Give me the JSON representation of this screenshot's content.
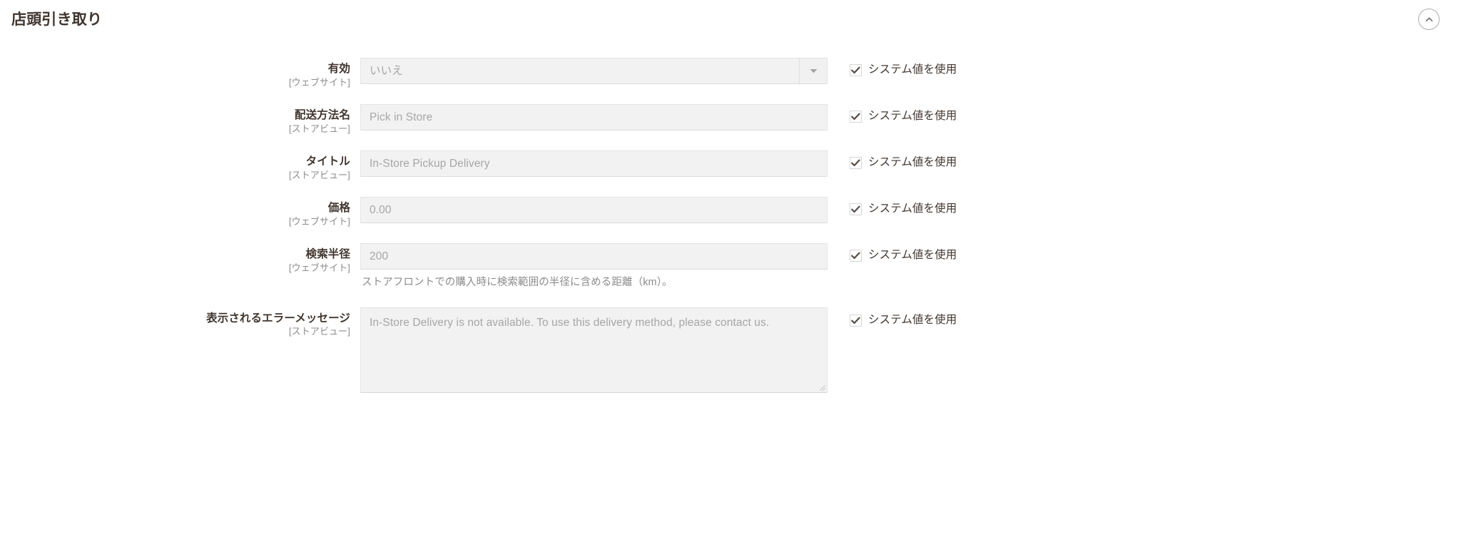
{
  "section": {
    "title": "店頭引き取り",
    "collapse_icon": "chevron-up-circle-icon"
  },
  "common": {
    "use_system_value_label": "システム値を使用",
    "scope_website": "[ウェブサイト]",
    "scope_storeview": "[ストアビュー]"
  },
  "fields": [
    {
      "label": "有効",
      "scope": "[ウェブサイト]",
      "type": "select",
      "value": "いいえ",
      "use_system": "システム値を使用",
      "checked": true
    },
    {
      "label": "配送方法名",
      "scope": "[ストアビュー]",
      "type": "text",
      "value": "Pick in Store",
      "use_system": "システム値を使用",
      "checked": true
    },
    {
      "label": "タイトル",
      "scope": "[ストアビュー]",
      "type": "text",
      "value": "In-Store Pickup Delivery",
      "use_system": "システム値を使用",
      "checked": true
    },
    {
      "label": "価格",
      "scope": "[ウェブサイト]",
      "type": "text",
      "value": "0.00",
      "use_system": "システム値を使用",
      "checked": true
    },
    {
      "label": "検索半径",
      "scope": "[ウェブサイト]",
      "type": "text",
      "value": "200",
      "note": "ストアフロントでの購入時に検索範囲の半径に含める距離（km）。",
      "use_system": "システム値を使用",
      "checked": true
    },
    {
      "label": "表示されるエラーメッセージ",
      "scope": "[ストアビュー]",
      "type": "textarea",
      "value": "In-Store Delivery is not available. To use this delivery method, please contact us.",
      "use_system": "システム値を使用",
      "checked": true
    }
  ],
  "colors": {
    "heading": "#41362f",
    "field_bg": "#f2f2f2",
    "field_border": "#e3e3e3",
    "muted_text": "#a6a6a6",
    "scope_text": "#8c8c8c"
  }
}
